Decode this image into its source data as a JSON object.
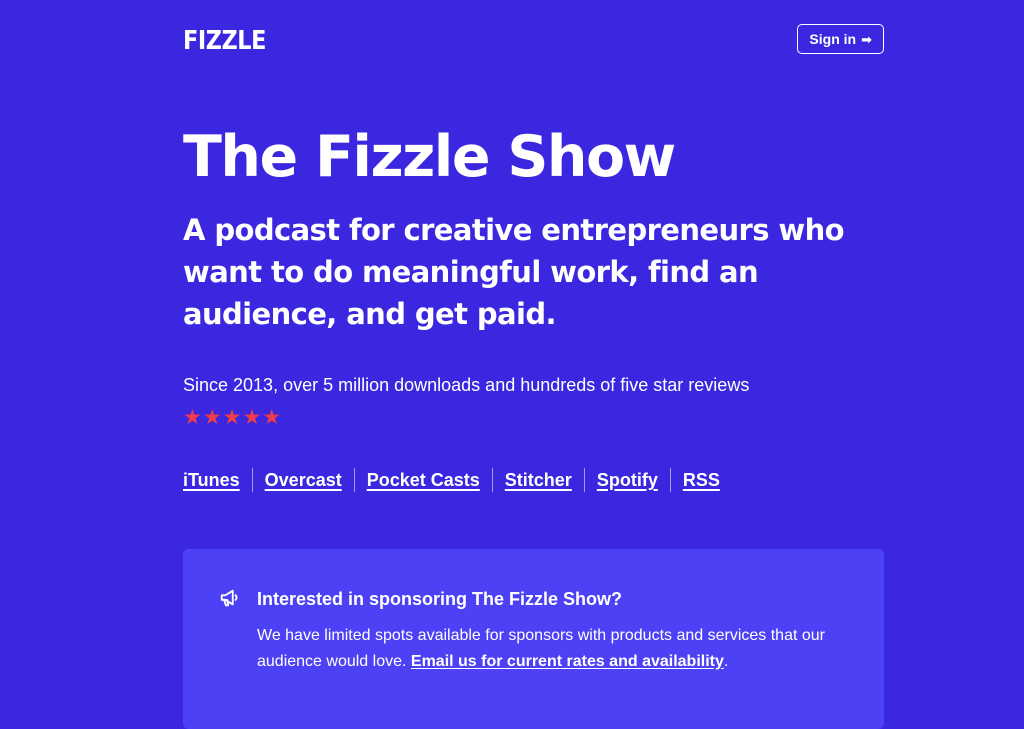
{
  "header": {
    "logo": "FIZZLE",
    "signin_label": "Sign in",
    "signin_arrow": "➡"
  },
  "hero": {
    "title": "The Fizzle Show",
    "tagline": "A podcast for creative entrepreneurs who want to do meaningful work, find an audience, and get paid.",
    "since": "Since 2013, over 5 million downloads and hundreds of five star reviews",
    "rating": 5,
    "stars": [
      "★",
      "★",
      "★",
      "★",
      "★"
    ]
  },
  "links": [
    "iTunes",
    "Overcast",
    "Pocket Casts",
    "Stitcher",
    "Spotify",
    "RSS"
  ],
  "sponsor": {
    "icon": "megaphone-icon",
    "title": "Interested in sponsoring The Fizzle Show?",
    "body": "We have limited spots available for sponsors with products and services that our audience would love. ",
    "link_label": "Email us for current rates and availability",
    "trailing": "."
  },
  "colors": {
    "background": "#3b27e0",
    "card": "#4d41f5",
    "star": "#ef3b4b",
    "text": "#ffffff"
  }
}
